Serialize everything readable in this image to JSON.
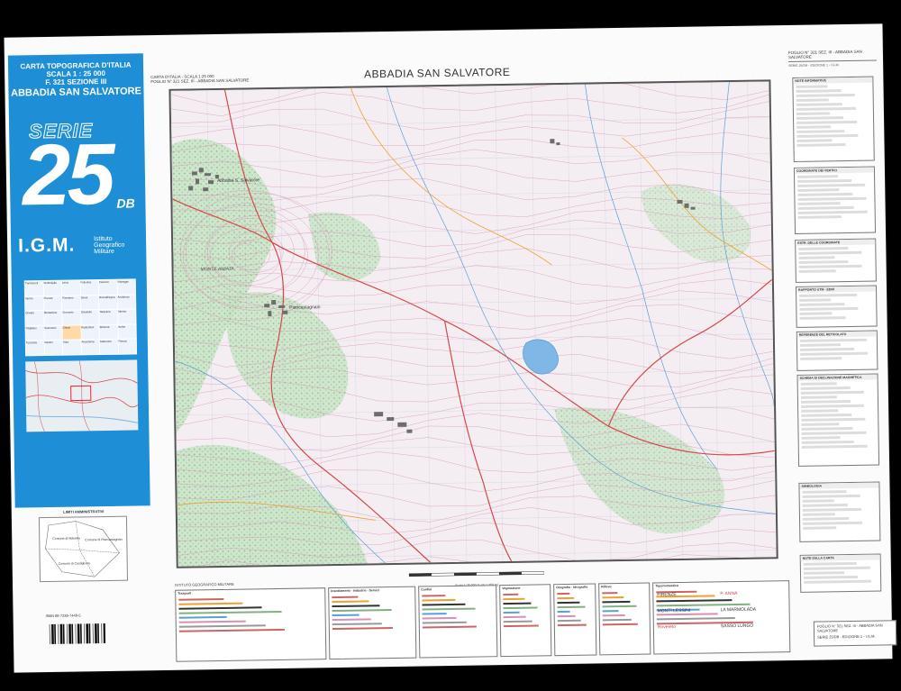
{
  "cover": {
    "line1": "CARTA TOPOGRAFICA D'ITALIA",
    "line2": "SCALA 1 : 25 000",
    "line3": "F. 321 SEZIONE III",
    "sheet_name": "ABBADIA SAN SALVATORE",
    "serie_word": "SERIE",
    "serie_number": "25",
    "serie_suffix": "DB",
    "igm": "I.G.M.",
    "igm_sub": "Istituto Geografico Militare"
  },
  "index_grid_labels": [
    "Pontremoli",
    "Ventimiglia",
    "Lerici",
    "Follonica",
    "Cascina",
    "Viareggio",
    "Vernio",
    "Firenze",
    "Piombino",
    "Siena",
    "Roccalbegna",
    "Arcidosso",
    "Orvieto",
    "Montalcino",
    "Grosseto",
    "Orbetello",
    "Tarquinia",
    "Viterbo",
    "Pitigliano",
    "Scansano",
    "Chiusi",
    "Radicofani",
    "Bolsena",
    "Ischia",
    "Tuscania",
    "Canino",
    "Vulci",
    "Ansedonia",
    "Talamone",
    "Pienza"
  ],
  "header": {
    "left_line1": "CARTA D'ITALIA - SCALA 1:25 000",
    "left_line2": "FOGLIO N° 321 SEZ. III - ABBADIA SAN SALVATORE",
    "title": "ABBADIA SAN SALVATORE"
  },
  "map_labels": {
    "town1": "Abbadia S. Salvatore",
    "town2": "Piancastagnaio",
    "ridge": "MONTE AMIATA"
  },
  "scale_text": "Scala 1:25 000 (1 cm = 250 m)",
  "legend_columns": [
    "Trasporti",
    "Insediamenti - Industrie - Servizi",
    "Confini",
    "Vegetazione",
    "Orografia - Idrografia",
    "Rilievo",
    "Toponomastica"
  ],
  "institute_text": "ISTITUTO GEOGRAFICO MILITARE",
  "toponym_samples": [
    "FIRENZE",
    "P. ANNA",
    "MONTI LESSINI",
    "LA MARMOLADA",
    "Rovereto",
    "SASSO LUNGO"
  ],
  "right_panel": {
    "top_title": "FOGLIO N° 321 SEZ. III - ABBADIA SAN SALVATORE",
    "sub_title": "SERIE 25/DB - EDIZIONE 1 - I.G.M.",
    "box_titles": [
      "NOTE INFORMATIVE",
      "COORDINATE DEI VERTICI",
      "ESTR. DELLE COORDINATE",
      "RAPPORTO UTM - ED50",
      "REFERENZE DEL RETICOLATO",
      "SCHEMA DI DECLINAZIONE MAGNETICA",
      "SIMBOLOGIA",
      "NOTE SULLA CARTA"
    ],
    "footer": "FOGLIO N° 321 SEZ. III - ABBADIA SAN SALVATORE",
    "footer_sub": "SERIE 25/DB - EDIZIONE 1 - I.G.M."
  },
  "admin": {
    "title": "LIMITI AMMINISTRATIVI",
    "labels": [
      "Comune di Abbadia",
      "Comune di Piancastagnaio",
      "Comune di Castiglione"
    ]
  },
  "isbn": "ISBN 88-7238-7448-5",
  "colors": {
    "cover_blue": "#1e8fd6",
    "map_pink": "#e6b8d0",
    "forest": "#bfe0c0",
    "lake": "#7fb8e6",
    "road_red": "#d44a4a"
  }
}
